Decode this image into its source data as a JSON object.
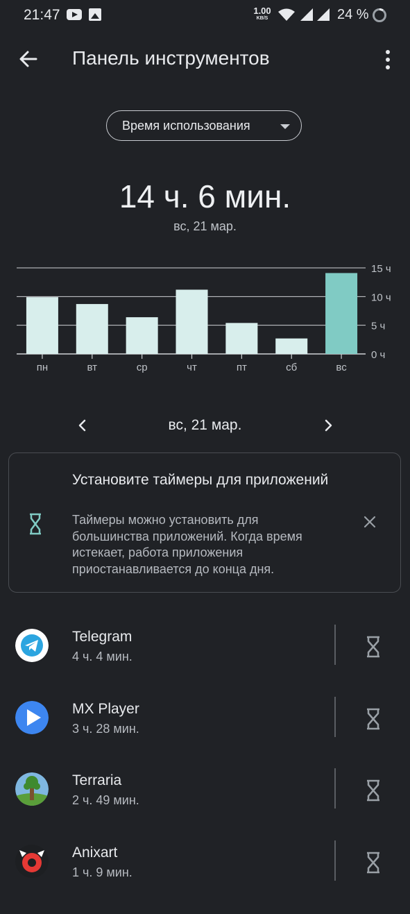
{
  "status_bar": {
    "time": "21:47",
    "net_speed_value": "1.00",
    "net_speed_unit": "KB/S",
    "battery": "24 %",
    "icons": [
      "youtube-icon",
      "image-icon",
      "wifi-icon",
      "signal-icon",
      "signal-icon",
      "battery-saver-icon"
    ]
  },
  "app_bar": {
    "title": "Панель инструментов",
    "back_icon": "arrow-back-icon",
    "menu_icon": "more-vert-icon"
  },
  "metric_select": {
    "selected": "Время использования"
  },
  "summary": {
    "total": "14 ч. 6 мин.",
    "date": "вс, 21 мар."
  },
  "chart_data": {
    "type": "bar",
    "categories": [
      "пн",
      "вт",
      "ср",
      "чт",
      "пт",
      "сб",
      "вс"
    ],
    "values": [
      9.9,
      8.7,
      6.4,
      11.2,
      5.4,
      2.7,
      14.1
    ],
    "highlight_index": 6,
    "ylim": [
      0,
      15
    ],
    "y_ticks": [
      "0 ч",
      "5 ч",
      "10 ч",
      "15 ч"
    ],
    "y_tick_values": [
      0,
      5,
      10,
      15
    ],
    "grid": true,
    "colors": {
      "bar": "#d8eeec",
      "highlight": "#80cbc4",
      "grid": "#d0d3d6",
      "axis_text": "#bfc3c8"
    }
  },
  "date_nav": {
    "label": "вс, 21 мар.",
    "prev_icon": "chevron-left-icon",
    "next_icon": "chevron-right-icon"
  },
  "timer_card": {
    "title": "Установите таймеры для приложений",
    "body": "Таймеры можно установить для большинства приложений. Когда время истекает, работа приложения приостанавливается до конца дня.",
    "icon": "hourglass-icon",
    "close_icon": "close-icon",
    "accent": "#80cbc4"
  },
  "apps": [
    {
      "name": "Telegram",
      "time": "4 ч. 4 мин.",
      "icon": "telegram-icon",
      "color": "#2ca5e0"
    },
    {
      "name": "MX Player",
      "time": "3 ч. 28 мин.",
      "icon": "mx-player-icon",
      "color": "#3d86f0"
    },
    {
      "name": "Terraria",
      "time": "2 ч. 49 мин.",
      "icon": "terraria-icon",
      "color": "#5a9e3a"
    },
    {
      "name": "Anixart",
      "time": "1 ч. 9 мин.",
      "icon": "anixart-icon",
      "color": "#e53935"
    }
  ]
}
